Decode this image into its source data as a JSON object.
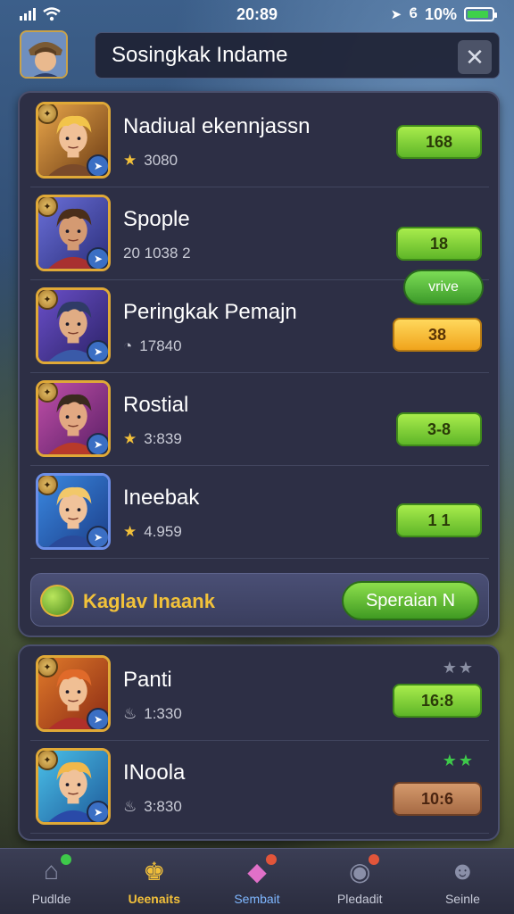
{
  "status_bar": {
    "time": "20:89",
    "battery": "10%",
    "battery_level": 0.9
  },
  "header": {
    "title": "Sosingkak Indame",
    "close_icon": "close-icon"
  },
  "leaderboard": [
    {
      "name": "Nadiual ekennjassn",
      "score": "3080",
      "score_icon": "star-icon",
      "value": "168",
      "pill": "green",
      "frame": "gold"
    },
    {
      "name": "Spople",
      "score": "20 1038 2",
      "score_icon": "",
      "value": "18",
      "pill": "green",
      "frame": "gold"
    },
    {
      "name": "Peringkak Pemajn",
      "score": "17840",
      "score_icon": "clock-icon",
      "value": "38",
      "pill": "yellow",
      "frame": "gold"
    },
    {
      "name": "Rostial",
      "score": "3:839",
      "score_icon": "star-icon",
      "value": "3-8",
      "pill": "green",
      "frame": "gold"
    },
    {
      "name": "Ineebak",
      "score": "4.959",
      "score_icon": "star-icon",
      "value": "1 1",
      "pill": "green",
      "frame": "blue"
    }
  ],
  "winner_chip": {
    "label": "vrive"
  },
  "banner": {
    "label": "Kaglav Inaank",
    "button": "Speraian N"
  },
  "leaderboard_bottom": [
    {
      "name": "Panti",
      "score": "1:330",
      "score_icon": "flame-icon",
      "value": "16:8",
      "pill": "green",
      "stars": "★★",
      "star_color": "#8a8fa3"
    },
    {
      "name": "INoola",
      "score": "3:830",
      "score_icon": "flame-icon",
      "value": "10:6",
      "pill": "brown",
      "stars": "★★",
      "star_color": "#3ec94a"
    }
  ],
  "nav": [
    {
      "label": "Pudlde",
      "icon": "home-icon",
      "glyph": "⌂",
      "state": "normal",
      "dot": "#3ec94a"
    },
    {
      "label": "Ueenaits",
      "icon": "trophy-icon",
      "glyph": "♚",
      "state": "active",
      "dot": ""
    },
    {
      "label": "Sembait",
      "icon": "gem-icon",
      "glyph": "◆",
      "state": "blue",
      "dot": "#e2553a"
    },
    {
      "label": "Pledadit",
      "icon": "target-icon",
      "glyph": "◉",
      "state": "normal",
      "dot": "#e2553a"
    },
    {
      "label": "Seinle",
      "icon": "profile-icon",
      "glyph": "☻",
      "state": "normal",
      "dot": ""
    }
  ]
}
